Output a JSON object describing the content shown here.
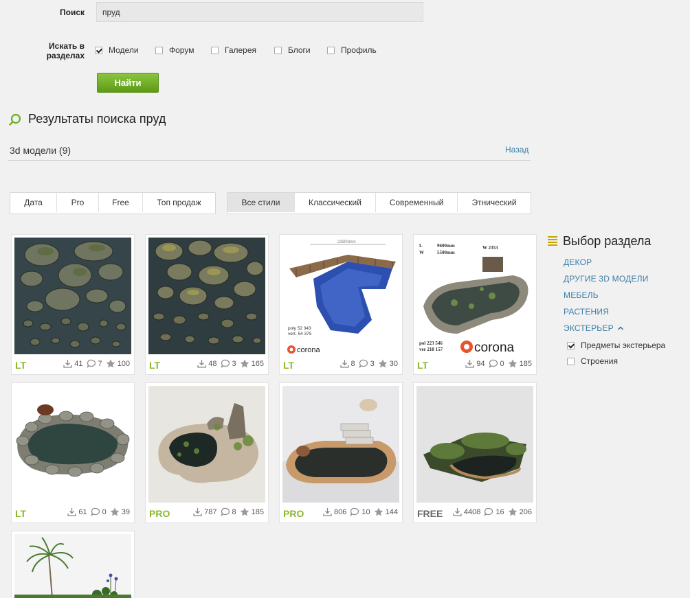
{
  "search": {
    "label": "Поиск",
    "query": "пруд",
    "sections_label_line1": "Искать в",
    "sections_label_line2": "разделах",
    "options": [
      {
        "label": "Модели",
        "checked": true
      },
      {
        "label": "Форум",
        "checked": false
      },
      {
        "label": "Галерея",
        "checked": false
      },
      {
        "label": "Блоги",
        "checked": false
      },
      {
        "label": "Профиль",
        "checked": false
      }
    ],
    "find_button": "Найти"
  },
  "results": {
    "title": "Результаты поиска пруд",
    "count_label": "3d модели (9)",
    "back_link": "Назад"
  },
  "sort_tabs": [
    "Дата",
    "Pro",
    "Free",
    "Топ продаж"
  ],
  "style_tabs": [
    "Все стили",
    "Классический",
    "Современный",
    "Этнический"
  ],
  "active_style_tab": "Все стили",
  "sidebar": {
    "title": "Выбор раздела",
    "categories": [
      "ДЕКОР",
      "ДРУГИЕ 3D МОДЕЛИ",
      "МЕБЕЛЬ",
      "РАСТЕНИЯ",
      "ЭКСТЕРЬЕР"
    ],
    "subcategories": [
      {
        "label": "Предметы экстерьера",
        "checked": true
      },
      {
        "label": "Строения",
        "checked": false
      }
    ]
  },
  "colors": {
    "accent_green": "#8ab82a",
    "link_blue": "#3a7ea8",
    "button_green": "#6fae22"
  },
  "chart_data": {
    "type": "table",
    "columns": [
      "tier",
      "downloads",
      "comments",
      "rating"
    ],
    "rows": [
      {
        "tier": "LT",
        "downloads": "41",
        "comments": "7",
        "rating": "100",
        "thumb_text": []
      },
      {
        "tier": "LT",
        "downloads": "48",
        "comments": "3",
        "rating": "165",
        "thumb_text": []
      },
      {
        "tier": "LT",
        "downloads": "8",
        "comments": "3",
        "rating": "30",
        "thumb_text": [
          "23300mm",
          "poly 52 343",
          "vert. 54 375",
          "corona"
        ]
      },
      {
        "tier": "LT",
        "downloads": "94",
        "comments": "0",
        "rating": "185",
        "thumb_text": [
          "L",
          "W",
          "9600mm",
          "5500mm",
          "W 2353",
          "pol 223 546",
          "ver 218 157",
          "corona"
        ]
      },
      {
        "tier": "LT",
        "downloads": "61",
        "comments": "0",
        "rating": "39",
        "thumb_text": []
      },
      {
        "tier": "PRO",
        "downloads": "787",
        "comments": "8",
        "rating": "185",
        "thumb_text": []
      },
      {
        "tier": "PRO",
        "downloads": "806",
        "comments": "10",
        "rating": "144",
        "thumb_text": []
      },
      {
        "tier": "FREE",
        "downloads": "4408",
        "comments": "16",
        "rating": "206",
        "thumb_text": []
      },
      {
        "tier": "",
        "downloads": "",
        "comments": "",
        "rating": "",
        "thumb_text": []
      }
    ]
  }
}
